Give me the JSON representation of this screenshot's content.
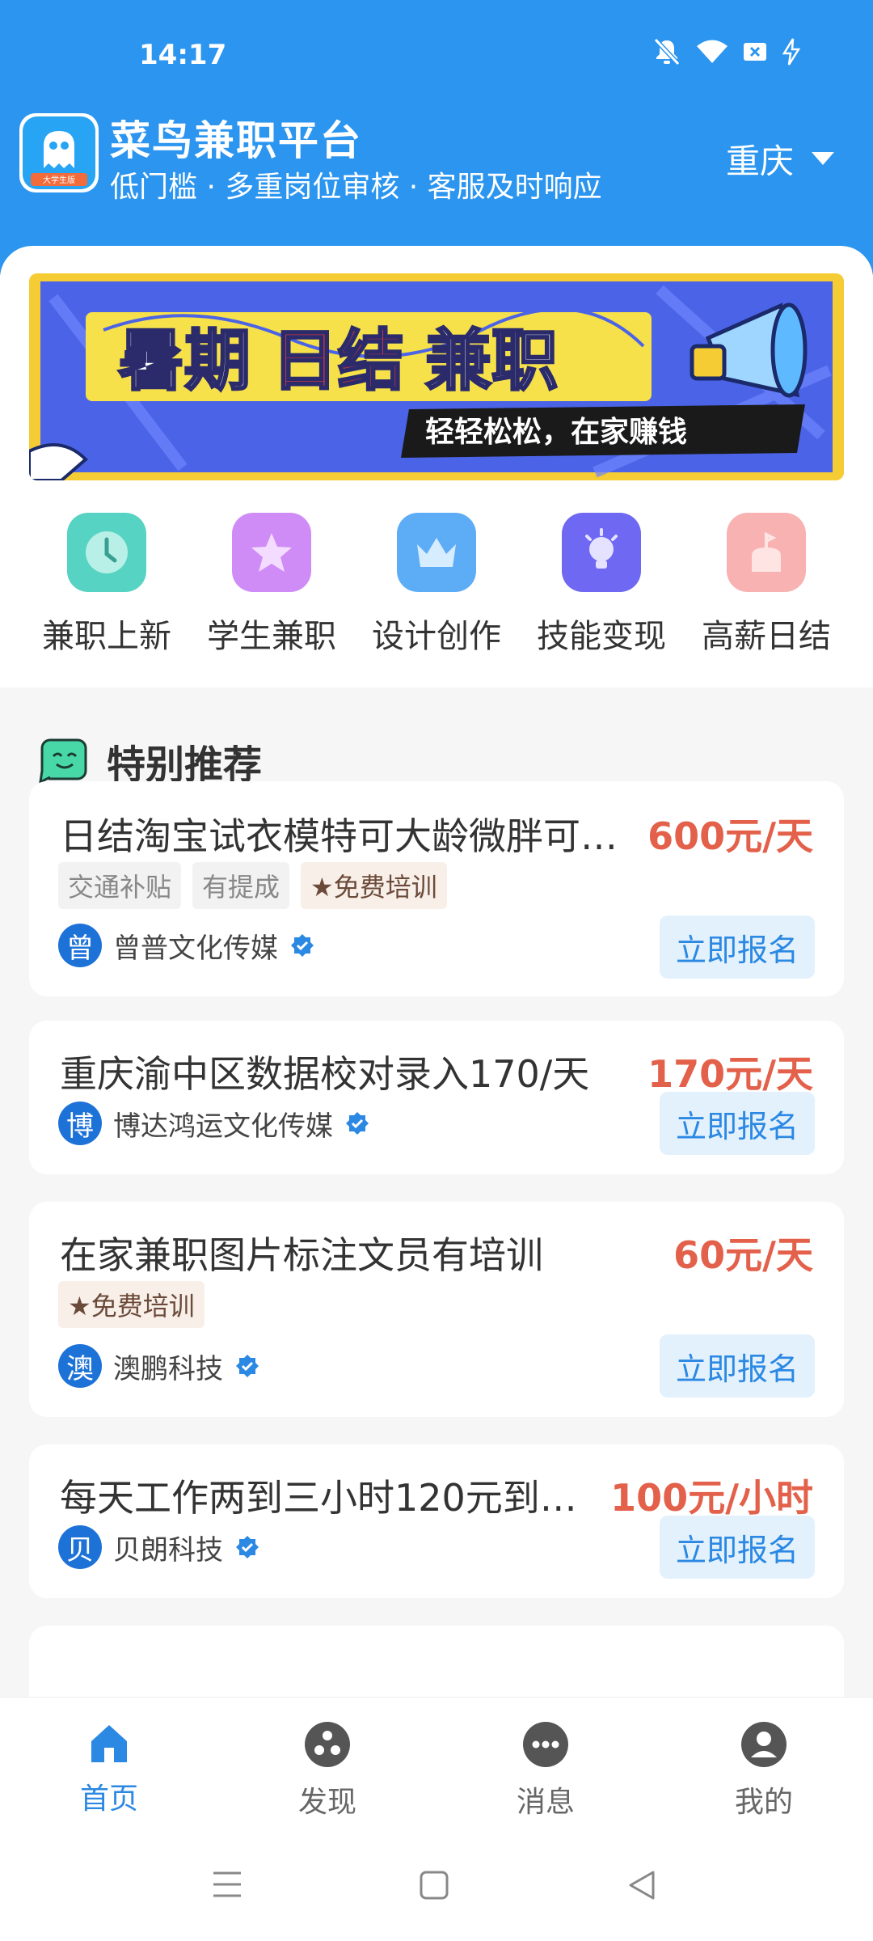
{
  "status_bar": {
    "time": "14:17"
  },
  "app": {
    "title": "菜鸟兼职平台",
    "slogan": "低门槛 · 多重岗位审核 · 客服及时响应",
    "logo_badge": "大学生版",
    "city": "重庆"
  },
  "banner": {
    "title_part1": "暑期",
    "title_part2": "日结",
    "title_part3": "兼职",
    "subtitle": "轻轻松松，在家赚钱"
  },
  "categories": [
    {
      "label": "兼职上新",
      "icon": "clock-icon",
      "color": "#3fc9b7"
    },
    {
      "label": "学生兼职",
      "icon": "star-icon",
      "color": "#c37df2"
    },
    {
      "label": "设计创作",
      "icon": "crown-icon",
      "color": "#4aa3f4"
    },
    {
      "label": "技能变现",
      "icon": "bulb-icon",
      "color": "#6a63f0"
    },
    {
      "label": "高薪日结",
      "icon": "cake-icon",
      "color": "#f7a6a6"
    }
  ],
  "recommend": {
    "title": "特别推荐"
  },
  "jobs": [
    {
      "title": "日结淘宝试衣模特可大龄微胖可…",
      "salary": "600元/天",
      "tags": [
        "交通补贴",
        "有提成",
        "★免费培训"
      ],
      "company_initial": "曾",
      "company": "曾普文化传媒",
      "apply": "立即报名"
    },
    {
      "title": "重庆渝中区数据校对录入170/天",
      "salary": "170元/天",
      "tags": [],
      "company_initial": "博",
      "company": "博达鸿运文化传媒",
      "apply": "立即报名"
    },
    {
      "title": "在家兼职图片标注文员有培训",
      "salary": "60元/天",
      "tags": [
        "★免费培训"
      ],
      "company_initial": "澳",
      "company": "澳鹏科技",
      "apply": "立即报名"
    },
    {
      "title": "每天工作两到三小时120元到…",
      "salary": "100元/小时",
      "tags": [],
      "company_initial": "贝",
      "company": "贝朗科技",
      "apply": "立即报名"
    }
  ],
  "bottom_nav": [
    {
      "label": "首页",
      "icon": "home-icon",
      "active": true
    },
    {
      "label": "发现",
      "icon": "discover-icon",
      "active": false
    },
    {
      "label": "消息",
      "icon": "message-icon",
      "active": false
    },
    {
      "label": "我的",
      "icon": "profile-icon",
      "active": false
    }
  ],
  "colors": {
    "brand": "#2b95ef",
    "salary": "#e3604a",
    "accent": "#2b88e3"
  }
}
